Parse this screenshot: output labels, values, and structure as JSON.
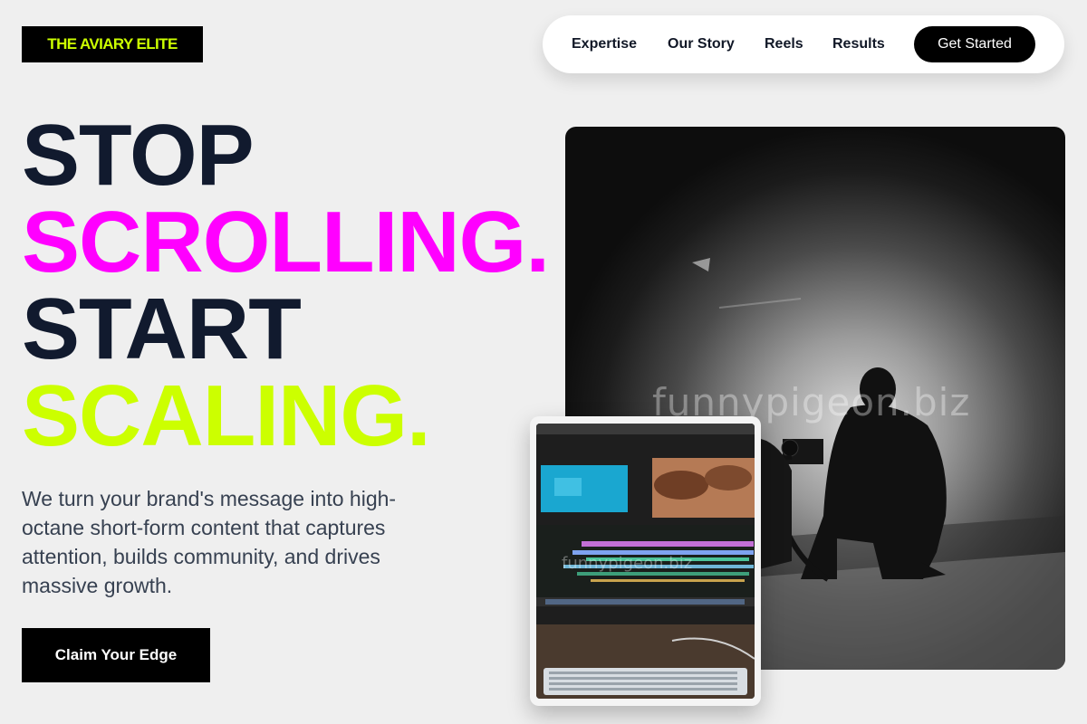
{
  "brand": {
    "logo_text": "THE AVIARY ELITE",
    "accent_lime": "#ccff00",
    "accent_magenta": "#ff00ff"
  },
  "nav": {
    "links": [
      "Expertise",
      "Our Story",
      "Reels",
      "Results"
    ],
    "cta_label": "Get Started"
  },
  "hero": {
    "line1": "STOP",
    "line2": "SCROLLING.",
    "line3": "START",
    "line4": "SCALING.",
    "description": "We turn your brand's message into high-octane short-form content that captures attention, builds community, and drives massive growth.",
    "cta_label": "Claim Your Edge"
  },
  "images": {
    "main_watermark": "funnypigeon.biz",
    "main_icon": "film-crew-photo",
    "inset_icon": "video-editing-photo",
    "inset_watermark": "funnypigeon.biz"
  }
}
